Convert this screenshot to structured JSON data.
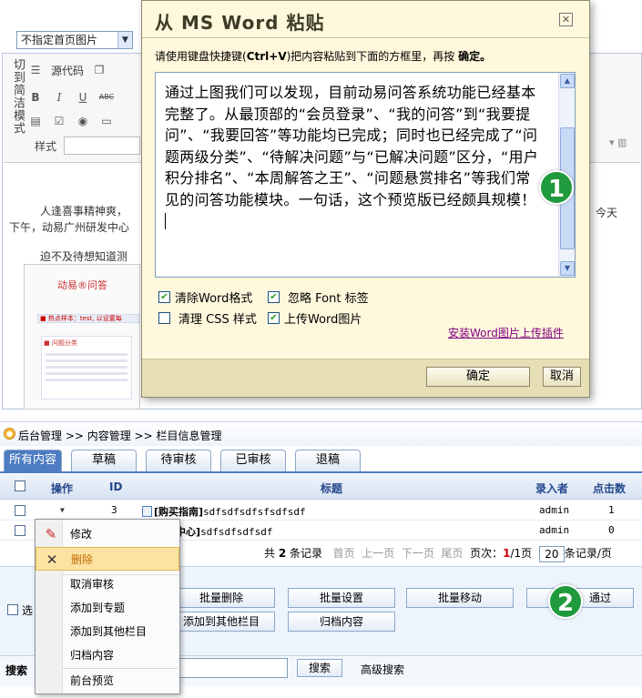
{
  "editor": {
    "homepic_select": "不指定首页图片",
    "side_label": "切到简洁模式",
    "source_label": "源代码",
    "style_label": "样式",
    "body_line1": "人逢喜事精神爽，",
    "body_line2": "下午，动易广州研发中心",
    "body_line3": "迫不及待想知道测",
    "right_text": "今天",
    "preview_logo": "动易®问答",
    "preview_bar": "■ 热点样本：test, 以设置每",
    "preview_sub": "■ 问题分类"
  },
  "dialog": {
    "title": "从 MS Word 粘贴",
    "close": "✕",
    "instruction_pre": "请使用键盘快捷键(",
    "instruction_key": "Ctrl+V",
    "instruction_mid": ")把内容粘贴到下面的方框里，再按 ",
    "instruction_ok": "确定。",
    "paste_text": "通过上图我们可以发现，目前动易问答系统功能已经基本完整了。从最顶部的“会员登录”、“我的问答”到“我要提问”、“我要回答”等功能均已完成；同时也已经完成了“问题两级分类”、“待解决问题”与“已解决问题”区分，“用户积分排名”、“本周解答之王”、“问题悬赏排名”等我们常见的问答功能模块。一句话，这个预览版已经颇具规模！",
    "opt_clear_word": "清除Word格式",
    "opt_ignore_font": "忽略 Font 标签",
    "opt_clear_css": "清理 CSS 样式",
    "opt_upload_img": "上传Word图片",
    "install_link": "安装Word图片上传插件",
    "ok_label": "确定",
    "cancel_label": "取消"
  },
  "badges": {
    "one": "1",
    "two": "2"
  },
  "admin": {
    "breadcrumb": "后台管理 >> 内容管理 >> 栏目信息管理",
    "tabs": [
      "所有内容",
      "草稿",
      "待审核",
      "已审核",
      "退稿"
    ],
    "headers": {
      "op": "操作",
      "id": "ID",
      "title": "标题",
      "author": "录入者",
      "clicks": "点击数"
    },
    "rows": [
      {
        "id": "3",
        "title_tag": "[购买指南]",
        "title_rest": "sdfsdfsdfsfsdfsdf",
        "author": "admin",
        "clicks": "1"
      },
      {
        "id": "",
        "title_tag": "[服务中心]",
        "title_rest": "sdfsdfsdfsdf",
        "author": "admin",
        "clicks": "0"
      }
    ],
    "pager": {
      "total_pre": "共",
      "total": "2",
      "total_post": "条记录",
      "first": "首页",
      "prev": "上一页",
      "next": "下一页",
      "last": "尾页",
      "page_label": "页次：",
      "page_cur": "1",
      "page_all": "/1页",
      "per_page": "20",
      "per_page_post": "条记录/页"
    },
    "select_label": "选",
    "buttons": {
      "batch_delete": "批量删除",
      "batch_set": "批量设置",
      "batch_move": "批量移动",
      "pass": "通过",
      "add_other": "添加到其他栏目",
      "archive": "归档内容"
    },
    "search_label": "搜索",
    "search_btn": "搜索",
    "advanced": "高级搜索"
  },
  "menu": {
    "items": [
      "修改",
      "删除",
      "取消审核",
      "添加到专题",
      "添加到其他栏目",
      "归档内容",
      "前台预览"
    ]
  },
  "colors": {
    "accent": "#4d7cc2",
    "badge": "#1f9a3c",
    "dialog_bg": "#fff8dc"
  }
}
